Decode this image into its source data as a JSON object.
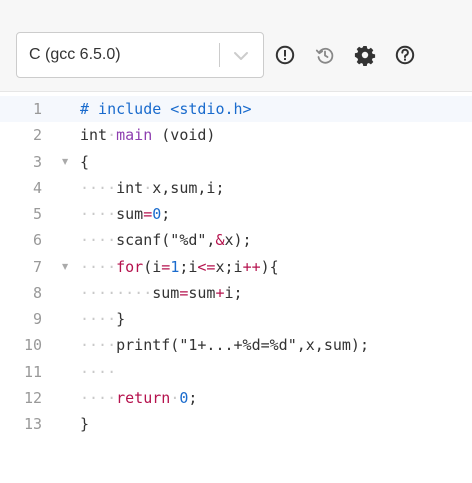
{
  "toolbar": {
    "language": "C (gcc 6.5.0)",
    "icons": [
      "exclamation-circle-icon",
      "history-icon",
      "gear-icon",
      "question-circle-icon"
    ]
  },
  "colors": {
    "keyword": "#b5124d",
    "number": "#1a6bcd",
    "directive": "#1a6bcd",
    "function": "#8e3fb0",
    "line_number": "#999999",
    "whitespace_dot": "#c9c9c9",
    "active_line": "#f5f8fd"
  },
  "editor": {
    "lines": [
      {
        "number": "1",
        "fold": false,
        "tokens": [
          {
            "t": "# include <stdio.h>",
            "c": "directive"
          }
        ]
      },
      {
        "number": "2",
        "fold": false,
        "tokens": [
          {
            "t": "int",
            "c": "type"
          },
          {
            "t": "·",
            "c": "ws"
          },
          {
            "t": "main",
            "c": "function"
          },
          {
            "t": " (void)",
            "c": "text"
          }
        ]
      },
      {
        "number": "3",
        "fold": true,
        "tokens": [
          {
            "t": "{",
            "c": "text"
          }
        ]
      },
      {
        "number": "4",
        "fold": false,
        "tokens": [
          {
            "t": "····",
            "c": "ws"
          },
          {
            "t": "int",
            "c": "type"
          },
          {
            "t": "·",
            "c": "ws"
          },
          {
            "t": "x,sum,i;",
            "c": "text"
          }
        ]
      },
      {
        "number": "5",
        "fold": false,
        "tokens": [
          {
            "t": "····",
            "c": "ws"
          },
          {
            "t": "sum",
            "c": "text"
          },
          {
            "t": "=",
            "c": "operator"
          },
          {
            "t": "0",
            "c": "number"
          },
          {
            "t": ";",
            "c": "text"
          }
        ]
      },
      {
        "number": "6",
        "fold": false,
        "tokens": [
          {
            "t": "····",
            "c": "ws"
          },
          {
            "t": "scanf(\"%d\",",
            "c": "text"
          },
          {
            "t": "&",
            "c": "operator"
          },
          {
            "t": "x);",
            "c": "text"
          }
        ]
      },
      {
        "number": "7",
        "fold": true,
        "tokens": [
          {
            "t": "····",
            "c": "ws"
          },
          {
            "t": "for",
            "c": "keyword"
          },
          {
            "t": "(i",
            "c": "text"
          },
          {
            "t": "=",
            "c": "operator"
          },
          {
            "t": "1",
            "c": "number"
          },
          {
            "t": ";i",
            "c": "text"
          },
          {
            "t": "<=",
            "c": "operator"
          },
          {
            "t": "x;i",
            "c": "text"
          },
          {
            "t": "++",
            "c": "operator"
          },
          {
            "t": "){",
            "c": "text"
          }
        ]
      },
      {
        "number": "8",
        "fold": false,
        "tokens": [
          {
            "t": "········",
            "c": "ws"
          },
          {
            "t": "sum",
            "c": "text"
          },
          {
            "t": "=",
            "c": "operator"
          },
          {
            "t": "sum",
            "c": "text"
          },
          {
            "t": "+",
            "c": "operator"
          },
          {
            "t": "i;",
            "c": "text"
          }
        ]
      },
      {
        "number": "9",
        "fold": false,
        "tokens": [
          {
            "t": "····",
            "c": "ws"
          },
          {
            "t": "}",
            "c": "text"
          }
        ]
      },
      {
        "number": "10",
        "fold": false,
        "tokens": [
          {
            "t": "····",
            "c": "ws"
          },
          {
            "t": "printf(\"1+...+%d=%d\",x,sum);",
            "c": "text"
          }
        ]
      },
      {
        "number": "11",
        "fold": false,
        "tokens": [
          {
            "t": "····",
            "c": "ws"
          }
        ]
      },
      {
        "number": "12",
        "fold": false,
        "tokens": [
          {
            "t": "····",
            "c": "ws"
          },
          {
            "t": "return",
            "c": "keyword"
          },
          {
            "t": "·",
            "c": "ws"
          },
          {
            "t": "0",
            "c": "number"
          },
          {
            "t": ";",
            "c": "text"
          }
        ]
      },
      {
        "number": "13",
        "fold": false,
        "tokens": [
          {
            "t": "}",
            "c": "text"
          }
        ]
      }
    ]
  }
}
